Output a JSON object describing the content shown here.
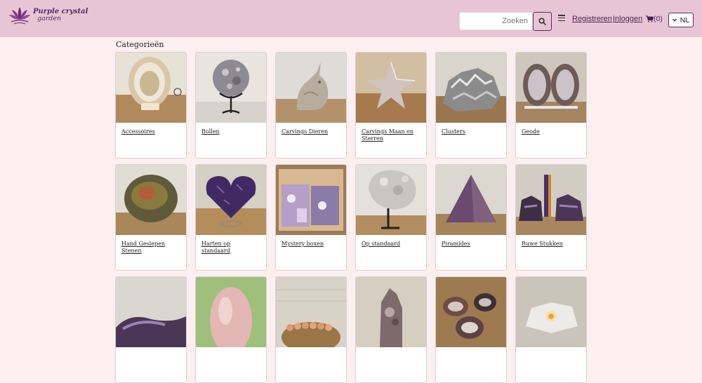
{
  "header": {
    "logo_line1": "Purple crystal",
    "logo_line2": "garden",
    "search_placeholder": "Zoeken",
    "register_label": "Registreren",
    "login_label": "Inloggen",
    "cart_count": "(0)",
    "language": "NL"
  },
  "main": {
    "title": "Categorieën",
    "categories": [
      {
        "label": "Accessoires",
        "image": "agate-slice-on-stand"
      },
      {
        "label": "Bollen",
        "image": "sphere-on-stand"
      },
      {
        "label": "Carvings Dieren",
        "image": "unicorn-carving"
      },
      {
        "label": "Carvings Maan en Sterren",
        "image": "star-carving"
      },
      {
        "label": "Clusters",
        "image": "crystal-cluster"
      },
      {
        "label": "Geode",
        "image": "geode-pair"
      },
      {
        "label": "Hand Geslepen Stenen",
        "image": "polished-stone"
      },
      {
        "label": "Harten op standaard",
        "image": "amethyst-heart"
      },
      {
        "label": "Mystery boxen",
        "image": "mystery-box"
      },
      {
        "label": "Op standaard",
        "image": "crystal-on-stand"
      },
      {
        "label": "Piramides",
        "image": "pyramid"
      },
      {
        "label": "Ruwe Stukken",
        "image": "rough-pieces"
      },
      {
        "label": "",
        "image": "amethyst-bowl"
      },
      {
        "label": "",
        "image": "rose-quartz-egg"
      },
      {
        "label": "",
        "image": "bead-bracelet"
      },
      {
        "label": "",
        "image": "crystal-point"
      },
      {
        "label": "",
        "image": "tumbled-agates"
      },
      {
        "label": "",
        "image": "candle-holder"
      }
    ]
  }
}
